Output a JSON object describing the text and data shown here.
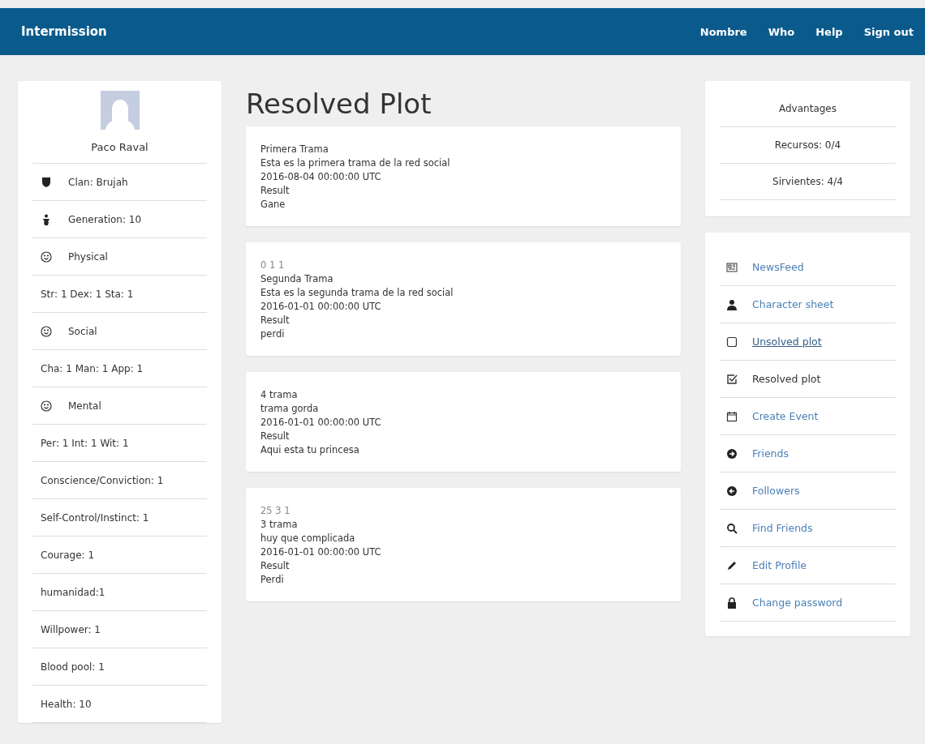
{
  "header": {
    "brand": "Intermission",
    "links": [
      "Nombre",
      "Who",
      "Help",
      "Sign out"
    ]
  },
  "profile": {
    "name": "Paco Raval",
    "stats": [
      "Clan: Brujah",
      "Generation: 10",
      "Physical",
      "Str: 1 Dex: 1 Sta: 1",
      "Social",
      "Cha: 1 Man: 1 App: 1",
      "Mental",
      "Per: 1 Int: 1 Wit: 1",
      "Conscience/Conviction: 1",
      "Self-Control/Instinct: 1",
      "Courage: 1",
      "humanidad:1",
      "Willpower: 1",
      "Blood pool: 1",
      "Health: 10"
    ]
  },
  "main": {
    "title": "Resolved Plot",
    "plots": [
      {
        "lines": [
          "Primera Trama",
          "Esta es la primera trama de la red social",
          "2016-08-04 00:00:00 UTC",
          "Result",
          "Gane"
        ]
      },
      {
        "votes": "0 1 1",
        "lines": [
          "Segunda Trama",
          "Esta es la segunda trama de la red social",
          "2016-01-01 00:00:00 UTC",
          "Result",
          "perdi"
        ]
      },
      {
        "lines": [
          "4 trama",
          "trama gorda",
          "2016-01-01 00:00:00 UTC",
          "Result",
          "Aqui esta tu princesa"
        ]
      },
      {
        "votes": "25 3 1",
        "lines": [
          "3 trama",
          "huy que complicada",
          "2016-01-01 00:00:00 UTC",
          "Result",
          "Perdi"
        ]
      }
    ]
  },
  "advantages": {
    "title": "Advantages",
    "items": [
      "Recursos: 0/4",
      "Sirvientes: 4/4"
    ]
  },
  "menu": [
    {
      "label": "NewsFeed",
      "selected": false,
      "hovered": false
    },
    {
      "label": "Character sheet",
      "selected": false,
      "hovered": false
    },
    {
      "label": "Unsolved plot",
      "selected": false,
      "hovered": true
    },
    {
      "label": "Resolved plot",
      "selected": true,
      "hovered": false
    },
    {
      "label": "Create Event",
      "selected": false,
      "hovered": false
    },
    {
      "label": "Friends",
      "selected": false,
      "hovered": false
    },
    {
      "label": "Followers",
      "selected": false,
      "hovered": false
    },
    {
      "label": "Find Friends",
      "selected": false,
      "hovered": false
    },
    {
      "label": "Edit Profile",
      "selected": false,
      "hovered": false
    },
    {
      "label": "Change password",
      "selected": false,
      "hovered": false
    }
  ]
}
